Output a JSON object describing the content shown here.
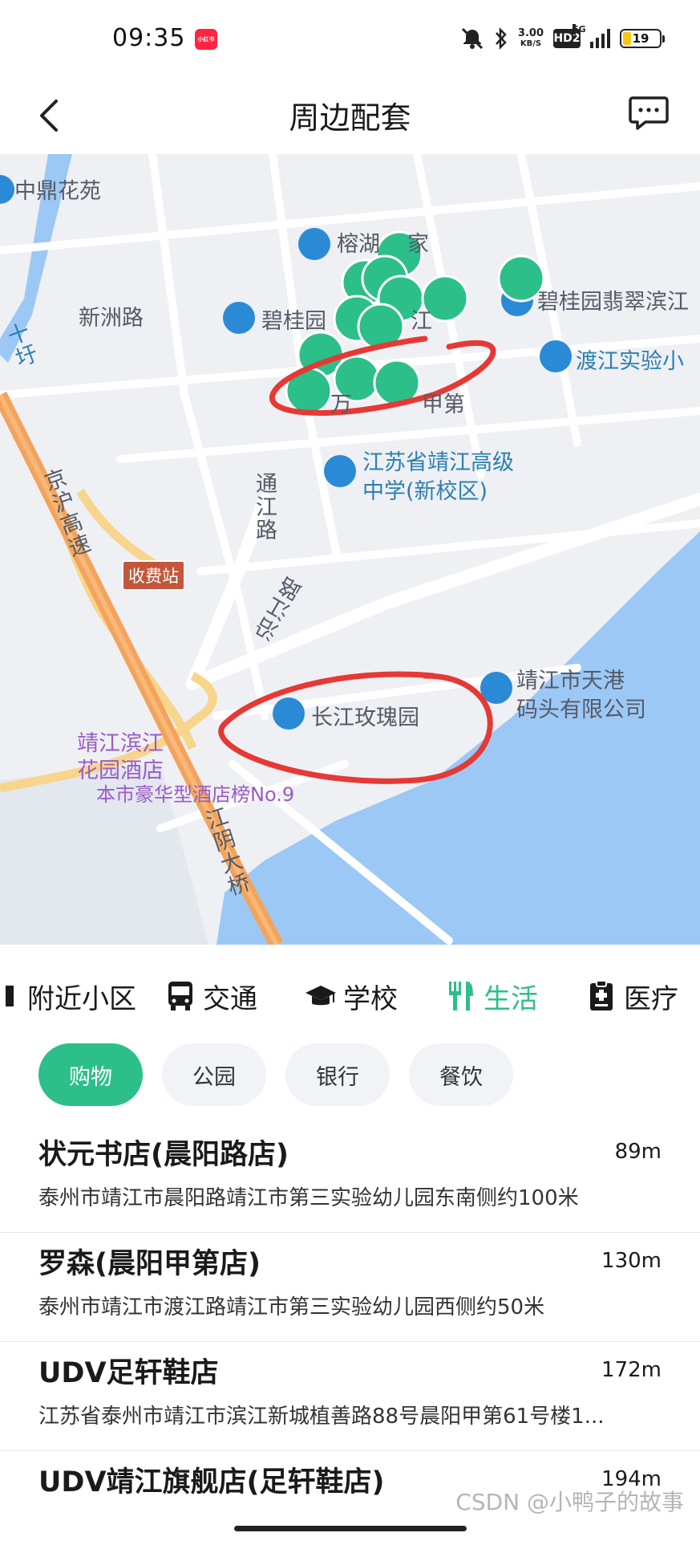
{
  "status_bar": {
    "time": "09:35",
    "app_badge": "小红书",
    "speed_value": "3.00",
    "speed_unit": "KB/S",
    "hd": "HD2",
    "network": "5G",
    "battery": "19"
  },
  "header": {
    "title": "周边配套"
  },
  "map": {
    "labels": {
      "zhongding": "中鼎花苑",
      "xinzhou_road": "新洲路",
      "rongxi": "榕湖",
      "rongxi_suffix": "家",
      "biguiyuan": "碧桂园",
      "biguiyuan_suffix": "江",
      "biguiyuan_feicui": "碧桂园翡翠滨江",
      "dujiang_school": "渡江实验小",
      "wanfang": "万",
      "wanfang_suffix": "甲第",
      "jiangsu_school_1": "江苏省靖江高级",
      "jiangsu_school_2": "中学(新校区)",
      "jinghu_highway": "京沪高速",
      "toll_station": "收费站",
      "tongjiang_road": "通江路",
      "yanjiang_road": "沿江路",
      "changjiang_rose": "长江玫瑰园",
      "tiangang_1": "靖江市天港",
      "tiangang_2": "码头有限公司",
      "hotel_1": "靖江滨江",
      "hotel_2": "花园酒店",
      "hotel_rank": "本市豪华型酒店榜No.9",
      "jiangyin_bridge": "江阴大桥",
      "shiwei_road": "十圩"
    },
    "colors": {
      "land": "#eef0f4",
      "water": "#9cc8f5",
      "highway": "#f3a35c",
      "pin_green": "#2dbf8a",
      "pin_blue": "#2a8ad6",
      "annotation": "#e53935"
    }
  },
  "tabs": [
    {
      "label": "附近小区",
      "icon": "home-icon",
      "active": false
    },
    {
      "label": "交通",
      "icon": "bus-icon",
      "active": false
    },
    {
      "label": "学校",
      "icon": "graduation-cap-icon",
      "active": false
    },
    {
      "label": "生活",
      "icon": "utensils-icon",
      "active": true
    },
    {
      "label": "医疗",
      "icon": "medical-report-icon",
      "active": false
    }
  ],
  "chips": [
    {
      "label": "购物",
      "active": true
    },
    {
      "label": "公园",
      "active": false
    },
    {
      "label": "银行",
      "active": false
    },
    {
      "label": "餐饮",
      "active": false
    }
  ],
  "list": [
    {
      "name": "状元书店(晨阳路店)",
      "distance": "89m",
      "address": "泰州市靖江市晨阳路靖江市第三实验幼儿园东南侧约100米"
    },
    {
      "name": "罗森(晨阳甲第店)",
      "distance": "130m",
      "address": "泰州市靖江市渡江路靖江市第三实验幼儿园西侧约50米"
    },
    {
      "name": "UDV足轩鞋店",
      "distance": "172m",
      "address": "江苏省泰州市靖江市滨江新城植善路88号晨阳甲第61号楼1..."
    },
    {
      "name": "UDV靖江旗舰店(足轩鞋店)",
      "distance": "194m",
      "address": ""
    }
  ],
  "watermark": "CSDN @小鸭子的故事"
}
